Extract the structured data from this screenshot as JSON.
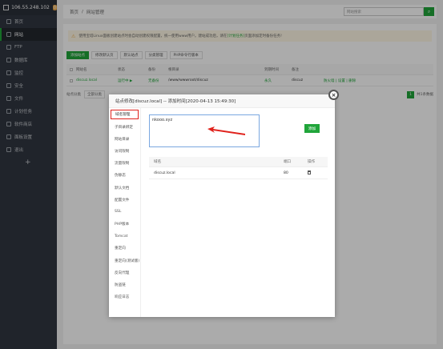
{
  "sidebar": {
    "server_ip": "106.55.248.102",
    "badge": "0",
    "items": [
      {
        "label": "首页",
        "icon": "home-icon"
      },
      {
        "label": "网站",
        "icon": "globe-icon",
        "active": true
      },
      {
        "label": "FTP",
        "icon": "ftp-icon"
      },
      {
        "label": "数据库",
        "icon": "database-icon"
      },
      {
        "label": "监控",
        "icon": "monitor-icon"
      },
      {
        "label": "安全",
        "icon": "shield-icon"
      },
      {
        "label": "文件",
        "icon": "folder-icon"
      },
      {
        "label": "计划任务",
        "icon": "clock-icon"
      },
      {
        "label": "软件商店",
        "icon": "store-icon"
      },
      {
        "label": "面板设置",
        "icon": "gear-icon"
      },
      {
        "label": "退出",
        "icon": "logout-icon"
      }
    ],
    "add_label": "+"
  },
  "topbar": {
    "home": "首页",
    "separator": "/",
    "current": "网站管理",
    "search_placeholder": "网站搜索"
  },
  "notice": {
    "text": "使用宝塔Linux面板创建站点时会自动创建权限配置，统一使用www用户。建站成功后，请在",
    "link": "[计划任务]",
    "suffix": "页面添加定时备份任务!"
  },
  "toolbar": [
    "添加站点",
    "修改默认页",
    "默认站点",
    "分类管理",
    "PHP命令行版本"
  ],
  "site_table": {
    "headers": [
      "网站名",
      "状态",
      "备份",
      "根目录",
      "到期时间",
      "备注"
    ],
    "rows": [
      {
        "name": "discuz.local",
        "status": "运行中 ▶",
        "backup": "无备份",
        "root": "/www/wwwroot/discuz",
        "expire": "永久",
        "note": "discuz",
        "ops": "防火墙 | 设置 | 删除"
      }
    ]
  },
  "pager": {
    "label": "站点分类",
    "select": "全部分类",
    "page": "1",
    "total": "共1条数据"
  },
  "modal": {
    "title": "站点修改[discuz.local] -- 添加时间[2020-04-13 15:49:30]",
    "nav": [
      "域名管理",
      "子目录绑定",
      "网站目录",
      "访问限制",
      "流量限制",
      "伪静态",
      "默认文档",
      "配置文件",
      "SSL",
      "PHP版本",
      "Tomcat",
      "重定向",
      "重定向(测试版)",
      "反向代理",
      "防盗链",
      "响应日志"
    ],
    "domain_input": "nkooo.xyz",
    "add_button": "添加",
    "domain_table": {
      "headers": [
        "域名",
        "端口",
        "操作"
      ],
      "rows": [
        {
          "domain": "discuz.local",
          "port": "80"
        }
      ]
    }
  },
  "colors": {
    "accent": "#20a53a",
    "sidebar": "#303641",
    "highlight": "#e0221c"
  }
}
